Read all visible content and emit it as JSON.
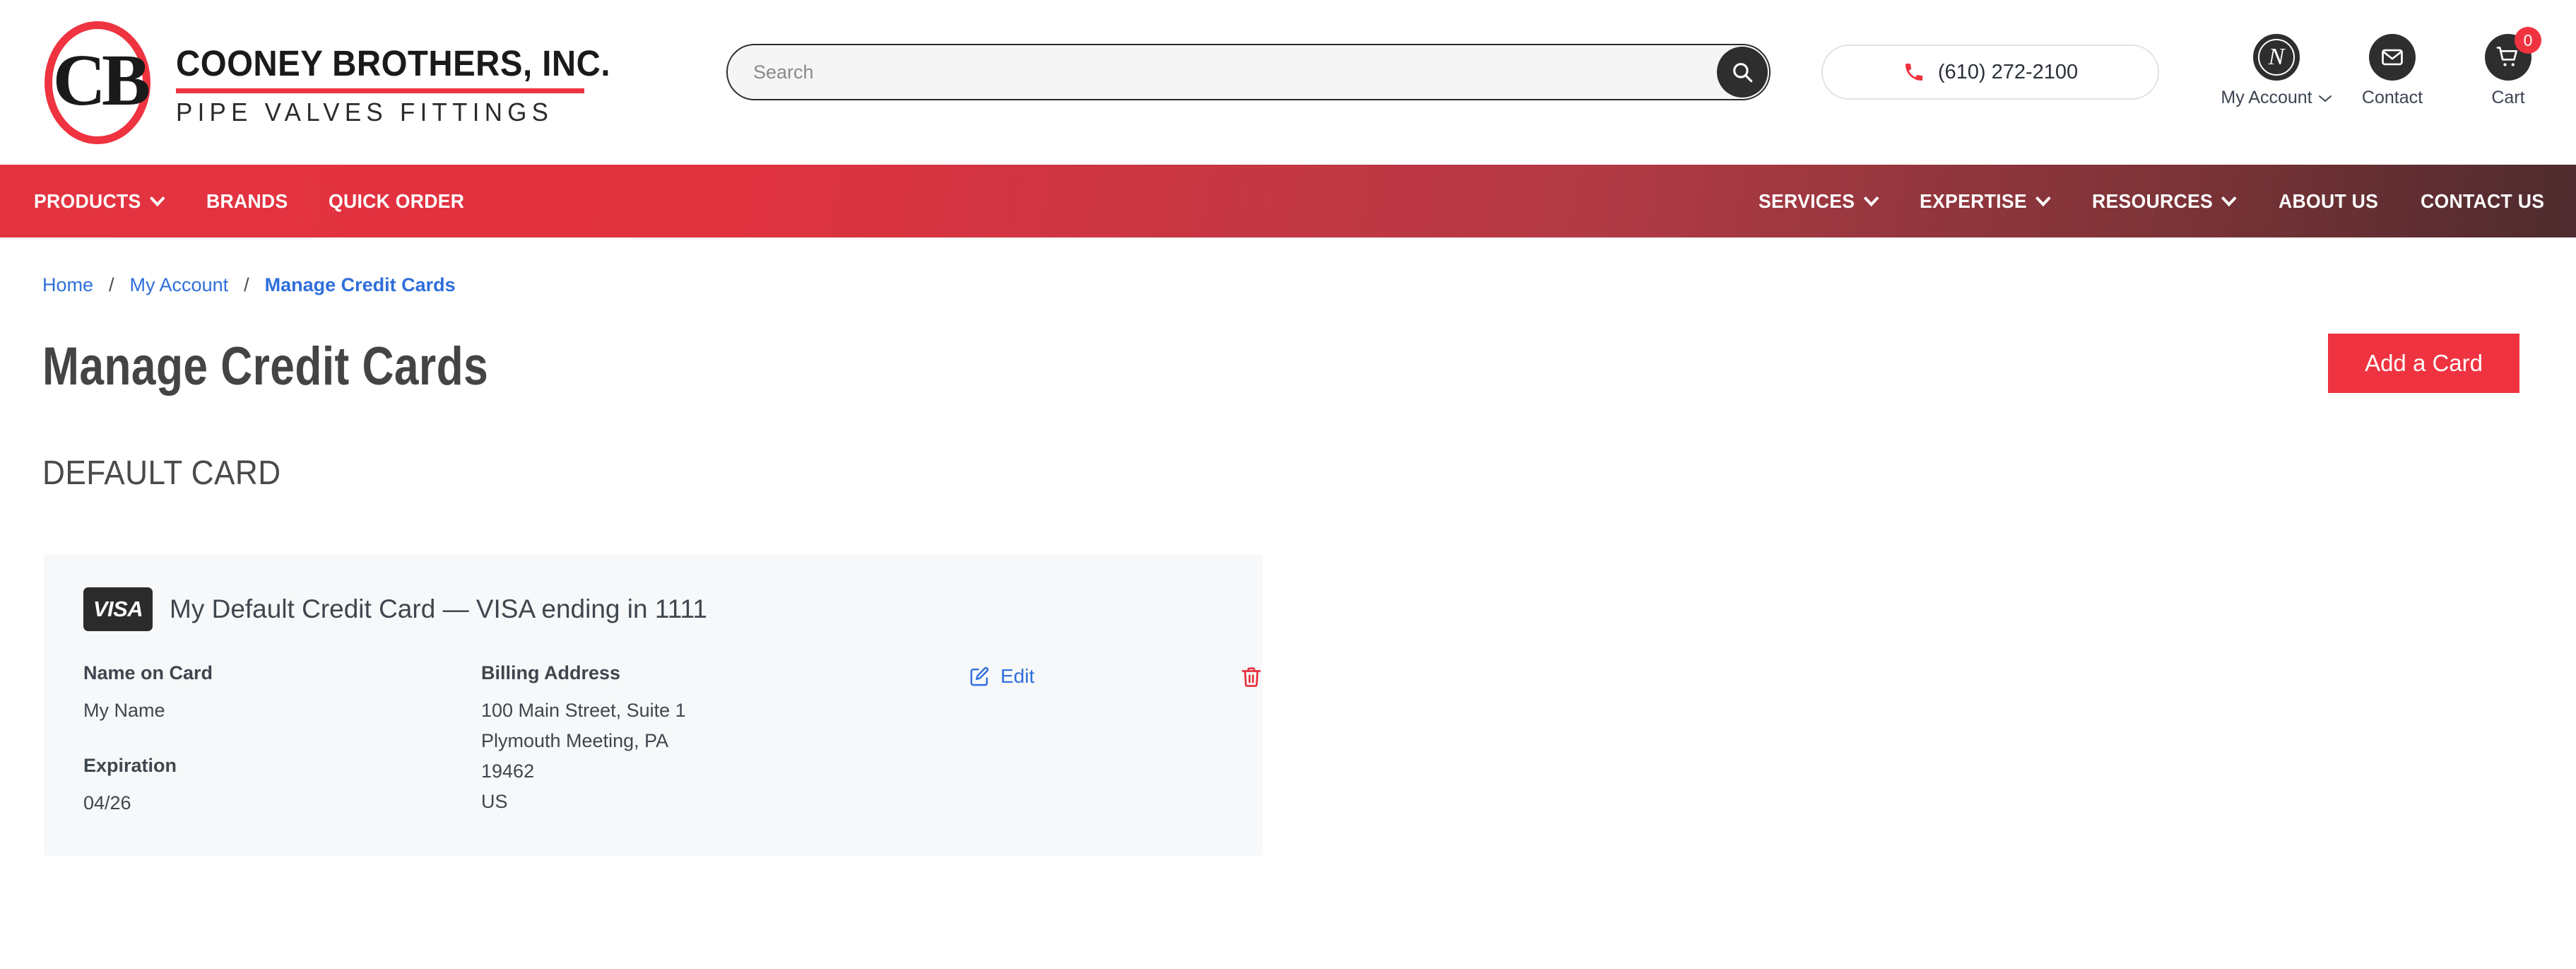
{
  "brand": {
    "monogram": "CB",
    "name": "COONEY BROTHERS, INC.",
    "tagline": "PIPE VALVES FITTINGS"
  },
  "header": {
    "search": {
      "placeholder": "Search",
      "value": ""
    },
    "phone": "(610) 272-2100",
    "utilities": [
      {
        "label": "My Account",
        "icon": "account-avatar-icon",
        "glyph": "N",
        "has_chevron": true
      },
      {
        "label": "Contact",
        "icon": "envelope-icon",
        "has_chevron": false
      },
      {
        "label": "Cart",
        "icon": "cart-icon",
        "has_chevron": false,
        "badge": "0"
      }
    ]
  },
  "nav": {
    "left": [
      {
        "label": "PRODUCTS",
        "has_chevron": true
      },
      {
        "label": "BRANDS",
        "has_chevron": false
      },
      {
        "label": "QUICK ORDER",
        "has_chevron": false
      }
    ],
    "right": [
      {
        "label": "SERVICES",
        "has_chevron": true
      },
      {
        "label": "EXPERTISE",
        "has_chevron": true
      },
      {
        "label": "RESOURCES",
        "has_chevron": true
      },
      {
        "label": "ABOUT US",
        "has_chevron": false
      },
      {
        "label": "CONTACT US",
        "has_chevron": false
      }
    ]
  },
  "breadcrumb": {
    "home": "Home",
    "sep1": "/",
    "my_account": "My Account",
    "sep2": "/",
    "current": "Manage Credit Cards"
  },
  "page": {
    "title": "Manage Credit Cards",
    "add_card_label": "Add a Card",
    "section_heading": "DEFAULT CARD"
  },
  "card": {
    "brand_logo": "VISA",
    "title": "My Default Credit Card — VISA ending in 1111",
    "name_label": "Name on Card",
    "name_value": "My Name",
    "expiration_label": "Expiration",
    "expiration_value": "04/26",
    "billing_label": "Billing Address",
    "billing_line1": "100 Main Street, Suite 1",
    "billing_line2": "Plymouth Meeting, PA",
    "billing_line3": "19462",
    "billing_line4": "US",
    "edit_label": "Edit",
    "delete_label": "Delete"
  },
  "colors": {
    "brand_red": "#ef3340",
    "nav_red": "#e43340",
    "link_blue": "#2f6fdb",
    "text_dark": "#3f464e",
    "panel_bg": "#f6f8f9"
  }
}
